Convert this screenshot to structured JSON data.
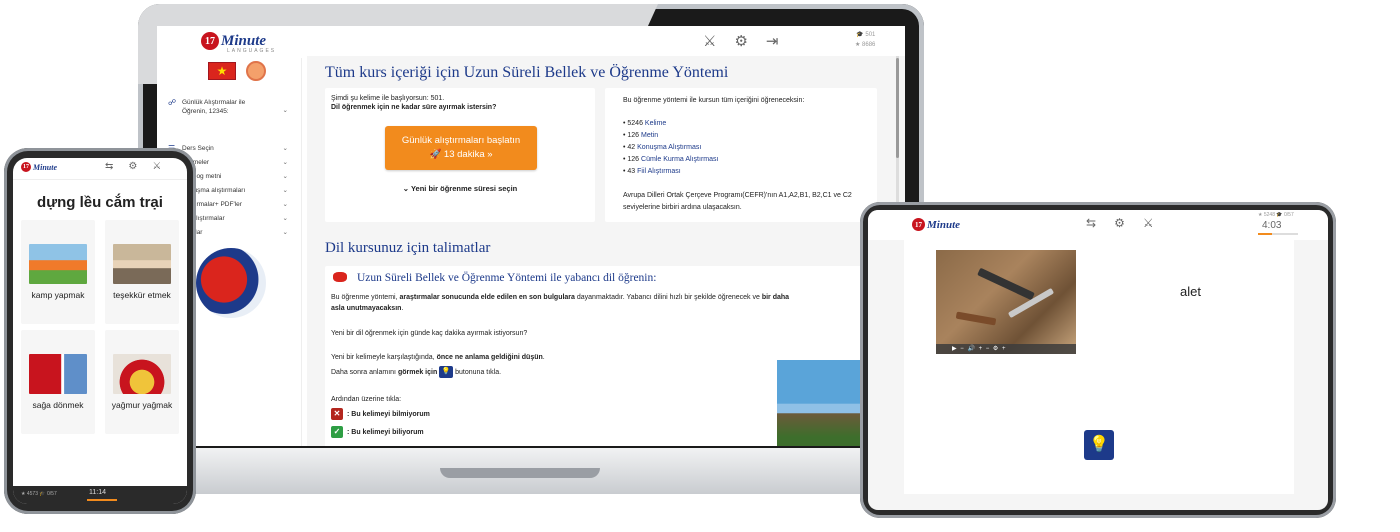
{
  "brand": {
    "logo_number": "17",
    "logo_text": "Minute",
    "logo_sub": "LANGUAGES"
  },
  "laptop": {
    "stats": {
      "line1": "🎓 501",
      "line2": "★ 8686"
    },
    "sidebar": {
      "flag": "★",
      "items": [
        {
          "icon": "☍",
          "label": "Günlük Alıştırmalar ile Öğrenin, 12345:"
        },
        {
          "icon": "☰",
          "label": "Ders Seçin"
        },
        {
          "icon": "",
          "label": "Kelimeler"
        },
        {
          "icon": "",
          "label": "Diyalog metni"
        },
        {
          "icon": "",
          "label": "Konuşma alıştırmaları"
        },
        {
          "icon": "",
          "label": "Alıştırmalar+ PDF'ler"
        },
        {
          "icon": "",
          "label": "Fiil Alıştırmalar"
        },
        {
          "icon": "",
          "label": "Ayarlar"
        }
      ]
    },
    "main": {
      "title": "Tüm kurs içeriği için Uzun Süreli Bellek ve Öğrenme Yöntemi",
      "card1": {
        "line1": "Şimdi şu kelime ile başlıyorsun: 501.",
        "line2": "Dil öğrenmek için ne kadar süre ayırmak istersin?",
        "button_line1": "Günlük alıştırmaları başlatın",
        "button_line2": "🚀 13 dakika »",
        "select_time": "⌄ Yeni bir öğrenme süresi seçin"
      },
      "card2": {
        "intro": "Bu öğrenme yöntemi ile kursun tüm içeriğini öğreneceksin:",
        "list": [
          {
            "count": "• 5246",
            "link": "Kelime"
          },
          {
            "count": "• 126",
            "link": "Metin"
          },
          {
            "count": "• 42",
            "link": "Konuşma Alıştırması"
          },
          {
            "count": "• 126",
            "link": "Cümle Kurma Alıştırması"
          },
          {
            "count": "• 43",
            "link": "Fiil Alıştırması"
          }
        ],
        "footer": "Avrupa Dilleri Ortak Çerçeve Programı(CEFR)'nın A1,A2,B1, B2,C1 ve C2 seviyelerine birbiri ardına ulaşacaksın."
      },
      "section2_title": "Dil kursunuz için talimatlar",
      "card3": {
        "subtitle": "Uzun Süreli Bellek ve Öğrenme Yöntemi ile yabancı dil öğrenin:",
        "p1_a": "Bu öğrenme yöntemi, ",
        "p1_b": "araştırmalar sonucunda elde edilen en son bulgulara",
        "p1_c": " dayanmaktadır. Yabancı dilini hızlı bir şekilde öğrenecek ve ",
        "p1_d": "bir daha",
        "p1_e": "asla unutmayacaksın",
        "p1_f": ".",
        "p2": "Yeni bir dil öğrenmek için günde kaç dakika ayırmak istiyorsun?",
        "p3_a": "Yeni bir kelimeyle karşılaştığında, ",
        "p3_b": "önce ne anlama geldiğini düşün",
        "p3_c": ".",
        "p4_a": "Daha sonra anlamını ",
        "p4_b": "görmek için",
        "p4_c": " butonuna tıkla.",
        "p5": "Ardından üzerine tıkla:",
        "opt_no": ": Bu kelimeyi bilmiyorum",
        "opt_yes": ": Bu kelimeyi biliyorum"
      }
    }
  },
  "phone": {
    "title": "dựng lều cắm trại",
    "tiles": [
      {
        "label": "kamp yapmak"
      },
      {
        "label": "teşekkür etmek"
      },
      {
        "label": "sağa dönmek"
      },
      {
        "label": "yağmur yağmak"
      }
    ],
    "stats": "★ 4573 🎓 0/57",
    "timer": "11:14"
  },
  "tablet": {
    "stats": "★ 5248 🎓 0/57",
    "timer": "4:03",
    "word": "alet",
    "player": "▶     −  🔊  +        −  ⚙  +"
  },
  "colors": {
    "accent_blue": "#1d3a8a",
    "accent_orange": "#f28b1d",
    "red": "#b3261e",
    "green": "#2e9e44"
  }
}
